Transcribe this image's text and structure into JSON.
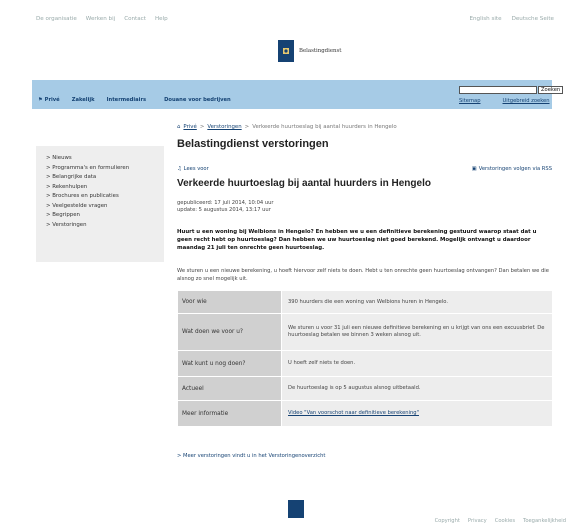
{
  "topbar": {
    "left_links": [
      "De organisatie",
      "Werken bij",
      "Contact",
      "Help"
    ],
    "right_links": [
      "English site",
      "Deutsche Seite"
    ]
  },
  "logo": {
    "name": "Belastingdienst"
  },
  "nav": {
    "items": [
      "Privé",
      "Zakelijk",
      "Intermediairs",
      "Douane voor bedrijven"
    ],
    "search_placeholder": "",
    "search_button": "Zoeken",
    "sitemap": "Sitemap",
    "advanced_search": "Uitgebreid zoeken"
  },
  "breadcrumb": {
    "items": [
      "Privé",
      "Verstoringen",
      "Verkeerde huurtoeslag bij aantal huurders in Hengelo"
    ],
    "separator": ">"
  },
  "sidebar": {
    "items": [
      "Nieuws",
      "Programma's en formulieren",
      "Belangrijke data",
      "Rekenhulpen",
      "Brochures en publicaties",
      "Veelgestelde vragen",
      "Begrippen",
      "Verstoringen"
    ]
  },
  "page": {
    "title": "Belastingdienst verstoringen",
    "lees_voor": "Lees voor",
    "volgen": "Verstoringen volgen via RSS",
    "article_title": "Verkeerde huurtoeslag bij aantal huurders in Hengelo",
    "published": "gepubliceerd: 17 juli 2014, 10:04 uur",
    "updated": "update: 5 augustus 2014, 13:17 uur",
    "intro": "Huurt u een woning bij Welbions in Hengelo? En hebben we u een definitieve berekening gestuurd waarop staat dat u geen recht hebt op huurtoeslag? Dan hebben we uw huurtoeslag niet goed berekend. Mogelijk ontvangt u daardoor maandag 21 juli ten onrechte geen huurtoeslag.",
    "body": "We sturen u een nieuwe berekening, u hoeft hiervoor zelf niets te doen. Hebt u ten onrechte geen huurtoeslag ontvangen? Dan betalen we die alsnog zo snel mogelijk uit.",
    "table": [
      {
        "key": "Voor wie",
        "value": "390 huurders die een woning van Welbions huren in Hengelo."
      },
      {
        "key": "Wat doen we voor u?",
        "value": "We sturen u voor 31 juli een nieuwe definitieve berekening en u krijgt van ons een excuusbrief. De huurtoeslag betalen we binnen 3 weken alsnog uit."
      },
      {
        "key": "Wat kunt u nog doen?",
        "value": "U hoeft zelf niets te doen."
      },
      {
        "key": "Actueel",
        "value": "De huurtoeslag is op 5 augustus alsnog uitbetaald."
      },
      {
        "key": "Meer informatie",
        "value": "Video \"Van voorschot naar definitieve berekening\""
      }
    ],
    "more_link": "> Meer verstoringen vindt u in het Verstoringenoverzicht"
  },
  "footer": {
    "links": [
      "Copyright",
      "Privacy",
      "Cookies",
      "Toegankelijkheid"
    ]
  },
  "colors": {
    "nav_bg": "#a6cbe6",
    "brand": "#154273",
    "sidebar_bg": "#eeeeee",
    "table_key_bg": "#d0d0d0",
    "table_val_bg": "#ededed"
  }
}
